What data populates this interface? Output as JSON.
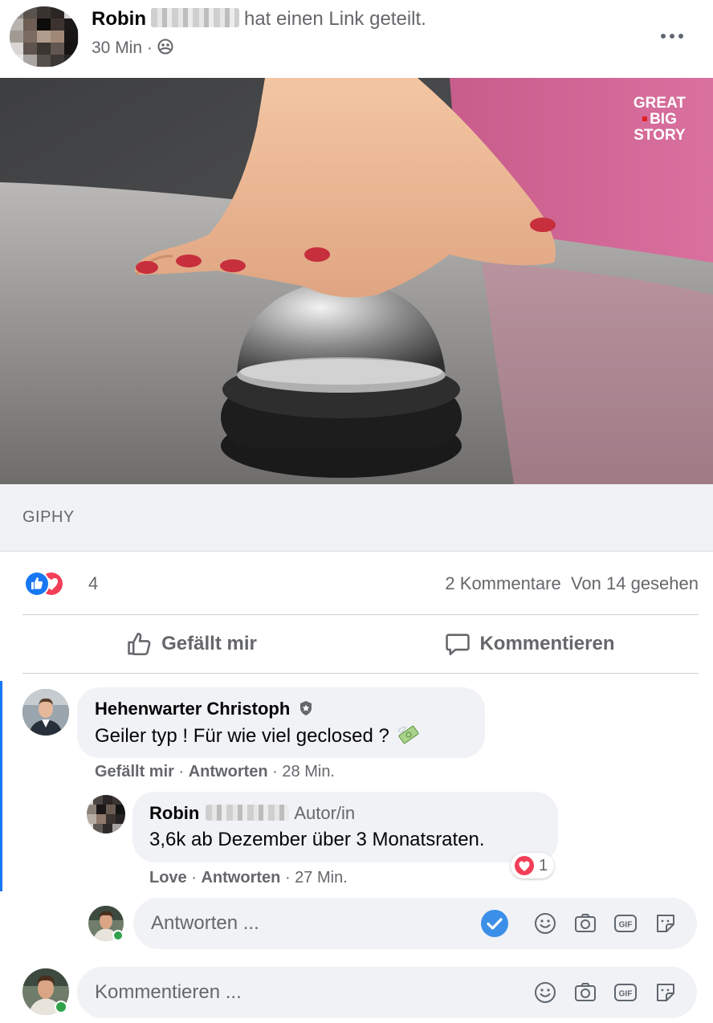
{
  "post": {
    "author_name": "Robin",
    "shared_text": "hat einen Link geteilt.",
    "time": "30 Min",
    "privacy_icon": "group-icon"
  },
  "media": {
    "watermark_line1": "GREAT",
    "watermark_line2": "BIG",
    "watermark_line3": "STORY",
    "source": "GIPHY"
  },
  "reactions": {
    "count": "4",
    "comments": "2 Kommentare",
    "views": "Von 14 gesehen"
  },
  "actions": {
    "like_label": "Gefällt mir",
    "comment_label": "Kommentieren"
  },
  "comments": [
    {
      "name": "Hehenwarter Christoph",
      "text": "Geiler typ ! Für wie viel geclosed ?",
      "like": "Gefällt mir",
      "reply": "Antworten",
      "time": "28 Min."
    }
  ],
  "reply": {
    "name": "Robin",
    "badge": "Autor/in",
    "text": "3,6k ab Dezember über 3 Monatsraten.",
    "reaction": "Love",
    "reply": "Antworten",
    "time": "27 Min.",
    "reaction_count": "1"
  },
  "reply_input": {
    "placeholder": "Antworten ..."
  },
  "comment_input": {
    "placeholder": "Kommentieren ..."
  },
  "colors": {
    "accent": "#1877f2",
    "love": "#f33e58",
    "online": "#31a24c"
  },
  "separator": "·"
}
